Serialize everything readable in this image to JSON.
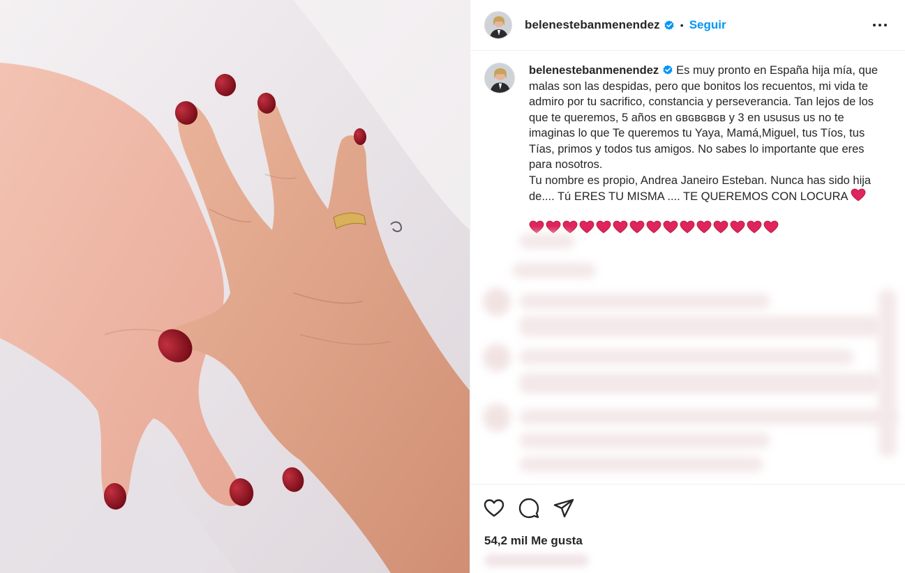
{
  "post": {
    "username": "belenestebanmenendez",
    "follow_label": "Seguir",
    "separator": "•",
    "caption_username": "belenestebanmenendez",
    "caption_text": "Es muy pronto en España hija mía, que malas son las despidas, pero que bonitos los recuentos, mi vida te admiro por tu sacrifico, constancia y perseverancia. Tan lejos de los que te queremos, 5 años en ɢʙɢʙɢʙɢʙ y 3 en ususus us no te imaginas lo que Te queremos tu Yaya, Mamá,Miguel, tus Tíos, tus Tías, primos y todos tus amigos. No sabes lo importante que eres para nosotros.\nTu nombre es propio, Andrea Janeiro Esteban. Nunca has sido hija de.... Tú ERES TU MISMA .... TE QUEREMOS CON LOCURA ",
    "hearts_count": 15,
    "likes_label": "54,2 mil Me gusta"
  },
  "colors": {
    "accent": "#0095f6",
    "verified": "#0095f6",
    "heart": "#e0245e",
    "text": "#262626",
    "nail_polish": "#8b0f1c"
  },
  "icons": {
    "more": "more-horizontal-icon",
    "verified": "verified-badge-icon",
    "like": "heart-outline-icon",
    "comment": "comment-bubble-icon",
    "share": "paper-plane-icon"
  }
}
